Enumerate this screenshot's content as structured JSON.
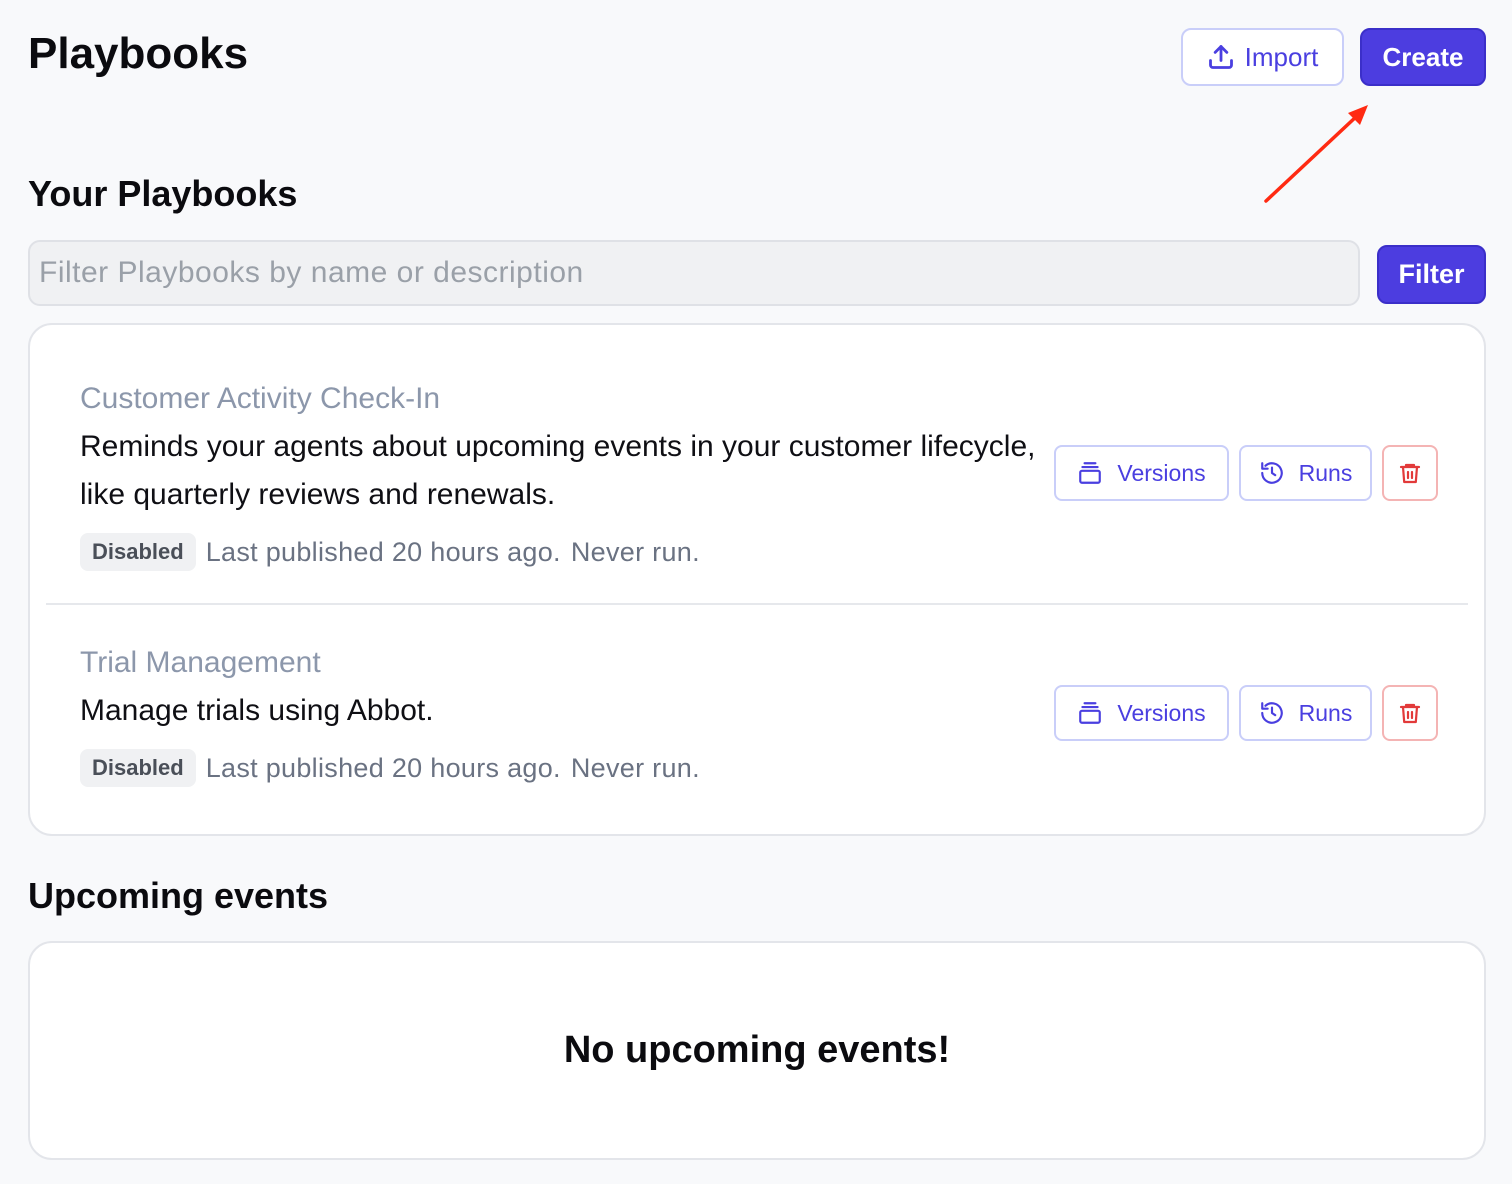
{
  "header": {
    "title": "Playbooks",
    "import_label": "Import",
    "create_label": "Create"
  },
  "your_playbooks": {
    "title": "Your Playbooks",
    "filter_placeholder": "Filter Playbooks by name or description",
    "filter_button": "Filter",
    "items": [
      {
        "name": "Customer Activity Check-In",
        "description": "Reminds your agents about upcoming events in your customer lifecycle, like quarterly reviews and renewals.",
        "status": "Disabled",
        "last_published": "Last published 20 hours ago.",
        "run_status": "Never run.",
        "versions_label": "Versions",
        "runs_label": "Runs"
      },
      {
        "name": "Trial Management",
        "description": "Manage trials using Abbot.",
        "status": "Disabled",
        "last_published": "Last published 20 hours ago.",
        "run_status": "Never run.",
        "versions_label": "Versions",
        "runs_label": "Runs"
      }
    ]
  },
  "upcoming_events": {
    "title": "Upcoming events",
    "empty_message": "No upcoming events!"
  },
  "colors": {
    "accent": "#4c3de0",
    "danger": "#e23a3a",
    "annotation_arrow": "#ff2a12"
  }
}
